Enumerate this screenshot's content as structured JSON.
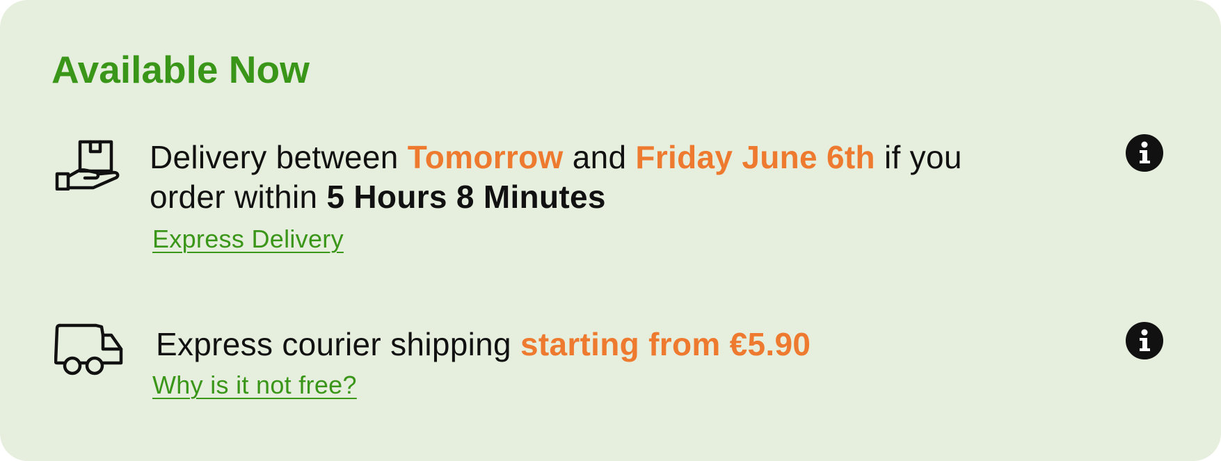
{
  "card": {
    "title": "Available Now",
    "colors": {
      "background": "#e6eedd",
      "title_green": "#3a9618",
      "highlight_orange": "#ee7a30",
      "text": "#111111"
    }
  },
  "delivery": {
    "icon": "hand-parcel-icon",
    "text_before": "Delivery between ",
    "date_start": "Tomorrow",
    "text_and": " and ",
    "date_end": "Friday June 6th",
    "text_if_you": " if you",
    "text_order_within": "order within ",
    "countdown": "5 Hours 8 Minutes",
    "link_label": "Express Delivery",
    "info_icon": "info-icon"
  },
  "shipping": {
    "icon": "delivery-van-icon",
    "text_before": "Express courier shipping ",
    "price_text": "starting from €5.90",
    "link_label": "Why is it not free?",
    "info_icon": "info-icon"
  }
}
